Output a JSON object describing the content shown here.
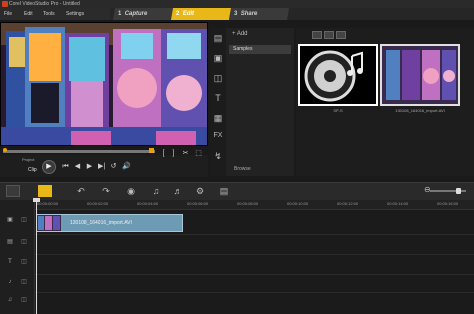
{
  "title": "Corel VideoStudio Pro - Untitled",
  "menu": [
    "File",
    "Edit",
    "Tools",
    "Settings"
  ],
  "steps": [
    {
      "num": "1",
      "label": "Capture"
    },
    {
      "num": "2",
      "label": "Edit"
    },
    {
      "num": "3",
      "label": "Share"
    }
  ],
  "player": {
    "project_label": "Project",
    "clip_label": "Clip",
    "controls": [
      "⏮",
      "◀",
      "▶",
      "▶|",
      "↺",
      "🔊"
    ]
  },
  "library": {
    "add_label": "Add",
    "folder": "Samples",
    "browse_label": "Browse",
    "thumb1_label": "SP-S",
    "thumb2_label": "130108_164016_import.AVI"
  },
  "timeline": {
    "ticks": [
      "00:00:00:00",
      "00:00:02:00",
      "00:00:04:00",
      "00:00:06:00",
      "00:00:08:00",
      "00:00:10:00",
      "00:00:12:00",
      "00:00:14:00",
      "00:00:16:00"
    ],
    "clip_name": "130108_164016_import.AVI",
    "progress": 0.0
  }
}
